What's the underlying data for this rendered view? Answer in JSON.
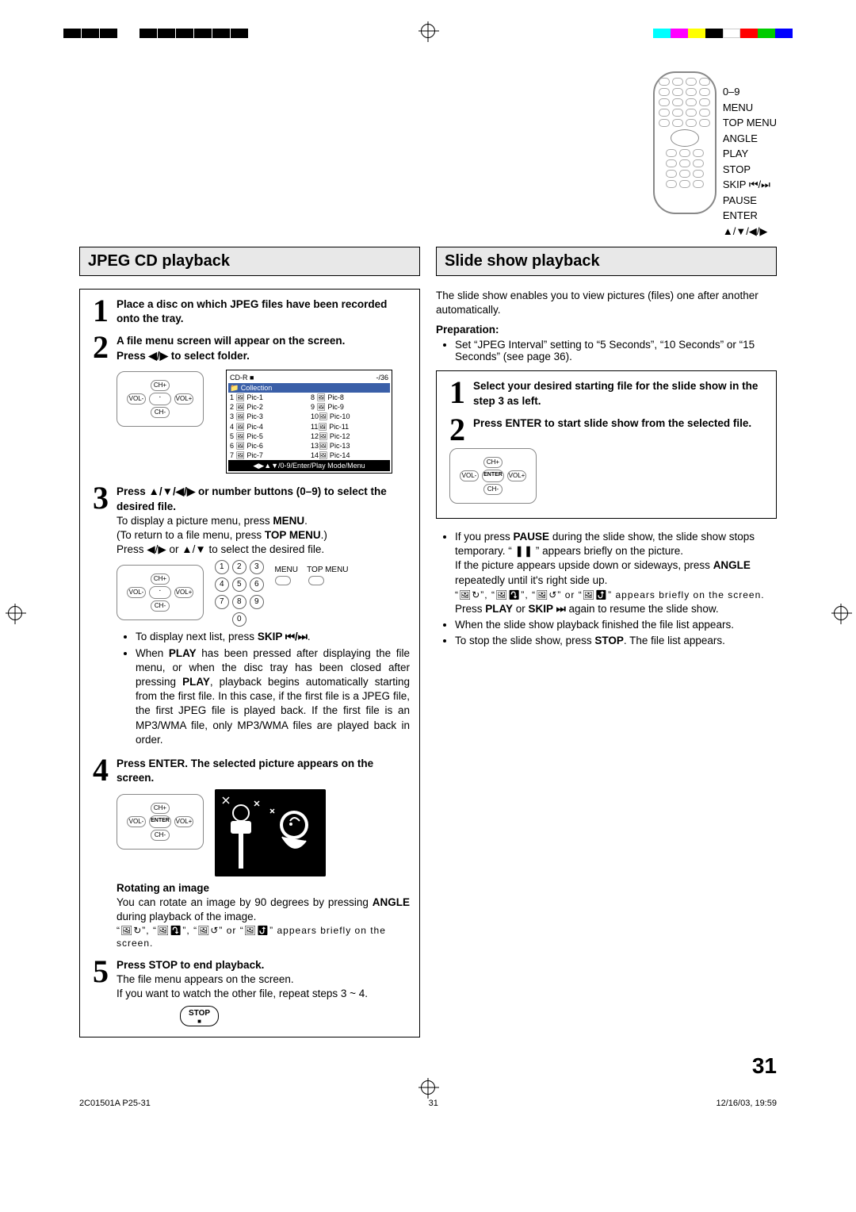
{
  "remote_labels": {
    "l1": "0–9",
    "l2": "MENU",
    "l3": "TOP MENU",
    "l4": "ANGLE",
    "l5": "PLAY",
    "l6": "STOP",
    "l7": "SKIP ⏮/⏭",
    "l8": "PAUSE",
    "l9": "ENTER",
    "l10": "▲/▼/◀/▶"
  },
  "left": {
    "title": "JPEG CD playback",
    "step1": "Place a disc on which JPEG files have been recorded onto the tray.",
    "step2a": "A file menu screen will appear on the screen.",
    "step2b": "Press ◀/▶ to select folder.",
    "filemenu": {
      "header_left": "CD-R ■",
      "header_right": "-/36",
      "folder": "Collection",
      "col1": [
        "1 🖼 Pic-1",
        "2 🖼 Pic-2",
        "3 🖼 Pic-3",
        "4 🖼 Pic-4",
        "5 🖼 Pic-5",
        "6 🖼 Pic-6",
        "7 🖼 Pic-7"
      ],
      "col2": [
        "8 🖼 Pic-8",
        "9 🖼 Pic-9",
        "10🖼 Pic-10",
        "11🖼 Pic-11",
        "12🖼 Pic-12",
        "13🖼 Pic-13",
        "14🖼 Pic-14"
      ],
      "footer": "◀▶▲▼/0-9/Enter/Play Mode/Menu"
    },
    "step3a": "Press ▲/▼/◀/▶ or number buttons (0–9) to select the desired file.",
    "step3b_1": "To display a picture menu, press ",
    "step3b_menu": "MENU",
    "step3b_2": ".",
    "step3c_1": "(To return to a file menu, press ",
    "step3c_top": "TOP MENU",
    "step3c_2": ".)",
    "step3d": "Press ◀/▶ or ▲/▼ to select the desired file.",
    "menu_label": "MENU",
    "topmenu_label": "TOP MENU",
    "bullet1_pre": "To display next list, press ",
    "bullet1_skip": "SKIP ⏮/⏭",
    "bullet1_post": ".",
    "bullet2_a": "When ",
    "bullet2_play": "PLAY",
    "bullet2_b": " has been pressed after displaying the file menu, or when the disc tray has been closed after pressing ",
    "bullet2_play2": "PLAY",
    "bullet2_c": ", playback begins automatically starting from the first file. In this case, if the first file is a JPEG file, the first JPEG file is played back. If the first file is an MP3/WMA file, only MP3/WMA files are played back in order.",
    "step4": "Press ENTER. The selected picture appears on the screen.",
    "rot_head": "Rotating an image",
    "rot_body_a": "You can rotate an image by 90 degrees by pressing ",
    "rot_body_angle": "ANGLE",
    "rot_body_b": " during playback of the image.",
    "rot_icons": "“🖼↻”, “🖼⤵”, “🖼↺” or “🖼⤴” appears briefly on the screen.",
    "step5a": "Press STOP to end playback.",
    "step5b": "The file menu appears on the screen.",
    "step5c": "If you want to watch the other file, repeat steps 3 ~ 4.",
    "stop_btn": "STOP"
  },
  "right": {
    "title": "Slide show playback",
    "intro": "The slide show enables you to view pictures (files) one after another automatically.",
    "prep_head": "Preparation:",
    "prep_body": "Set “JPEG Interval” setting to “5 Seconds”, “10 Seconds” or “15 Seconds” (see page 36).",
    "step1": "Select your desired starting file for the slide show in the step 3 as left.",
    "step2": "Press ENTER to start slide show from the selected file.",
    "b1_a": "If you press ",
    "b1_pause": "PAUSE",
    "b1_b": " during the slide show, the slide show stops temporary. “ ❚❚ ” appears briefly on the picture.",
    "b2_a": "If the picture appears upside down or sideways, press ",
    "b2_angle": "ANGLE",
    "b2_b": " repeatedly until it's right side up.",
    "b2_icons": "“🖼↻”, “🖼⤵”, “🖼↺” or “🖼⤴” appears briefly on the screen.",
    "b3_a": "Press ",
    "b3_play": "PLAY",
    "b3_b": " or ",
    "b3_skip": "SKIP ⏭",
    "b3_c": " again to resume the slide show.",
    "b4": "When the slide show playback finished the file list appears.",
    "b5_a": "To stop the slide show, press ",
    "b5_stop": "STOP",
    "b5_b": ". The file list appears."
  },
  "page_number": "31",
  "footer_left": "2C01501A P25-31",
  "footer_mid": "31",
  "footer_right": "12/16/03, 19:59",
  "dpad": {
    "ch_plus": "CH+",
    "ch_minus": "CH-",
    "vol_plus": "VOL+",
    "vol_minus": "VOL-",
    "enter": "ENTER"
  }
}
